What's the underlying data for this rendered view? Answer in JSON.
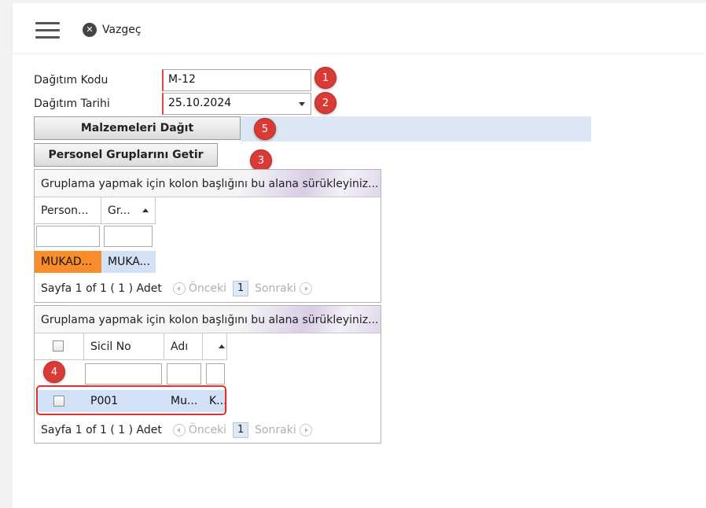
{
  "toolbar": {
    "menu_icon": "hamburger-icon",
    "cancel_icon": "close-circle-icon",
    "cancel_label": "Vazgeç"
  },
  "form": {
    "code_label": "Dağıtım Kodu",
    "code_value": "M-12",
    "date_label": "Dağıtım Tarihi",
    "date_value": "25.10.2024",
    "distribute_button": "Malzemeleri Dağıt",
    "get_groups_button": "Personel Gruplarını Getir"
  },
  "badges": [
    "1",
    "2",
    "3",
    "4",
    "5"
  ],
  "groups_grid": {
    "group_header": "Gruplama yapmak için kolon başlığını bu alana sürükleyiniz...",
    "columns": [
      "Person...",
      "Gr..."
    ],
    "rows": [
      {
        "col1": "MUKAD...",
        "col2": "MUKA..."
      }
    ],
    "pager": {
      "info": "Sayfa 1 of 1 ( 1 ) Adet",
      "prev": "Önceki",
      "page": "1",
      "next": "Sonraki"
    }
  },
  "personnel_grid": {
    "group_header": "Gruplama yapmak için kolon başlığını bu alana sürükleyiniz...",
    "columns": [
      "Sicil No",
      "Adı"
    ],
    "rows": [
      {
        "sicil": "P001",
        "adi": "Mu...",
        "extra": "K..."
      }
    ],
    "pager": {
      "info": "Sayfa 1 of 1 ( 1 ) Adet",
      "prev": "Önceki",
      "page": "1",
      "next": "Sonraki"
    }
  },
  "colors": {
    "badge": "#d93a36",
    "selected_orange": "#f98d2b",
    "selected_blue": "#d3e1f6",
    "required_border": "#e04848"
  }
}
